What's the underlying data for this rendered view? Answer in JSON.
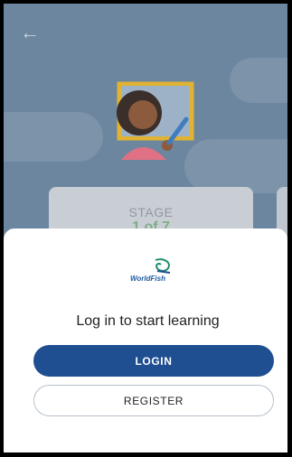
{
  "header": {
    "back_icon": "arrow-left-icon"
  },
  "stage": {
    "label": "STAGE",
    "value": "1 of 7"
  },
  "brand": {
    "name": "WorldFish",
    "logo_icon": "fish-logo-icon"
  },
  "auth": {
    "title": "Log in to start learning",
    "login_label": "LOGIN",
    "register_label": "REGISTER"
  },
  "colors": {
    "primary": "#1f4e91",
    "sheet": "#ffffff",
    "backdrop": "#6c86a0"
  }
}
